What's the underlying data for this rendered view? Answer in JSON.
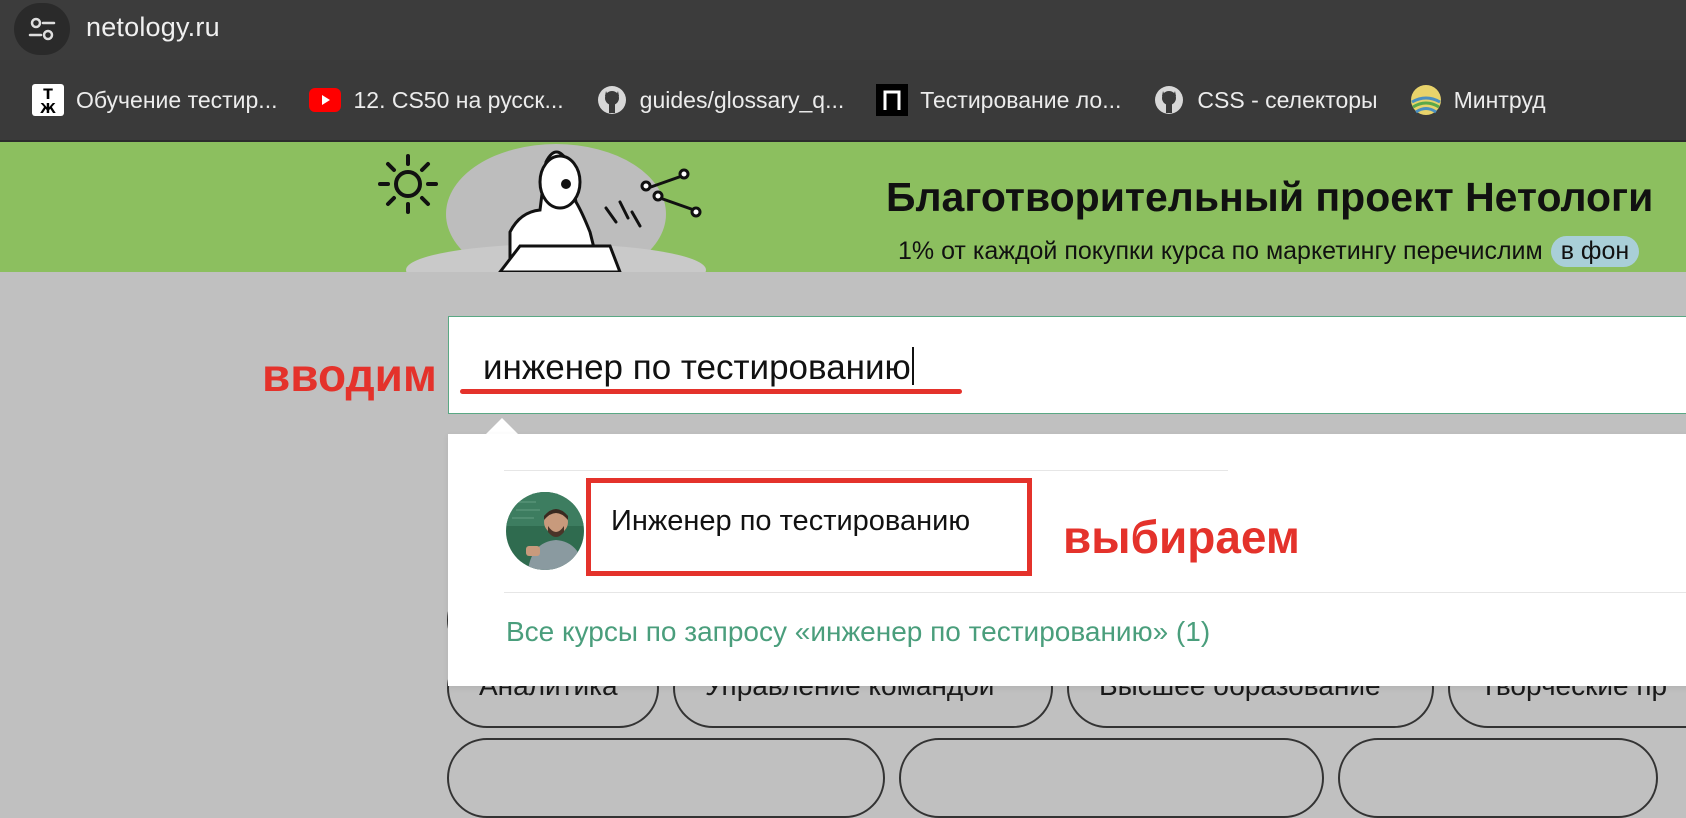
{
  "browser": {
    "url": "netology.ru",
    "bookmarks": [
      {
        "label": "Обучение тестир...",
        "icon": "tzh-icon"
      },
      {
        "label": "12. CS50 на русск...",
        "icon": "youtube-icon"
      },
      {
        "label": "guides/glossary_q...",
        "icon": "github-icon"
      },
      {
        "label": "Тестирование ло...",
        "icon": "p-logo-icon"
      },
      {
        "label": "CSS - селекторы",
        "icon": "github-icon"
      },
      {
        "label": "Минтруд",
        "icon": "mintrud-icon"
      }
    ]
  },
  "banner": {
    "title": "Благотворительный проект Нетологи",
    "subtitle": "1% от каждой покупки курса по маркетингу перечислим",
    "pill": "в фон"
  },
  "search": {
    "value": "инженер по тестированию"
  },
  "annotations": {
    "enter": "вводим",
    "choose": "выбираем"
  },
  "dropdown": {
    "result_label": "Инженер по тестированию",
    "all_results_link": "Все курсы по запросу «инженер по тестированию» (1)"
  },
  "chips": [
    {
      "label": "Аналитика"
    },
    {
      "label": "Управление командой"
    },
    {
      "label": "Высшее образование"
    },
    {
      "label": "Творческие пр"
    }
  ],
  "colors": {
    "annotation_red": "#e4322b",
    "brand_green": "#8cbf5f",
    "link_green": "#4a9e7c"
  }
}
